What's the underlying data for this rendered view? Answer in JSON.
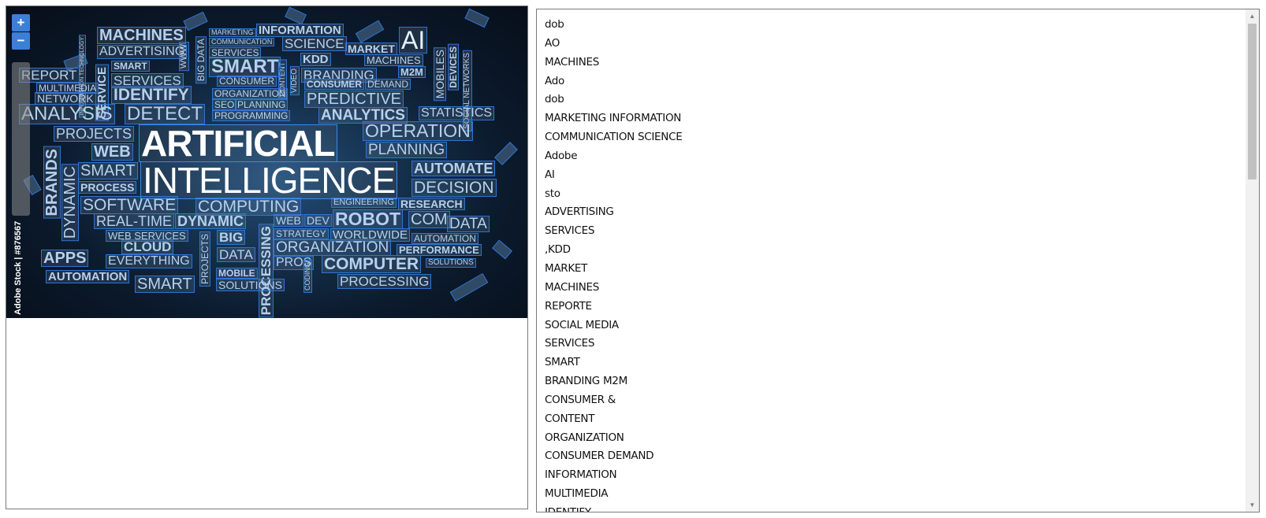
{
  "viewer": {
    "zoom_in_label": "+",
    "zoom_out_label": "−",
    "watermark": "Adobe Stock | #876567",
    "word_cloud": [
      "ARTIFICIAL",
      "INTELLIGENCE",
      "MACHINES",
      "ADVERTISING",
      "INFORMATION",
      "SCIENCE",
      "MARKETING",
      "COMMUNICATION",
      "SERVICES",
      "MARKET",
      "AI",
      "KDD",
      "MACHINES",
      "M2M",
      "BRANDING",
      "CONSUMER",
      "DEMAND",
      "SOCIAL MEDIA",
      "SMART",
      "REPORT",
      "MULTIMEDIA",
      "NETWORK",
      "IDENTIFY",
      "ORGANIZATION",
      "PREDICTIVE",
      "MOBILES",
      "DEVICES",
      "SOCIAL NETWORKS",
      "ANALYSIS",
      "DETECT",
      "SEO",
      "PLANNING",
      "PROGRAMMING",
      "ANALYTICS",
      "STATISTICS",
      "PROJECTS",
      "OPERATION",
      "WEB",
      "PLANNING",
      "BRANDS",
      "SMART",
      "AUTOMATE",
      "PROCESS",
      "DECISION",
      "SOFTWARE",
      "COMPUTING",
      "ENGINEERING",
      "RESEARCH",
      "SOLUTIONS",
      "REAL-TIME",
      "DYNAMIC",
      "WEB",
      "DEV",
      "ROBOT",
      "COM",
      "DATA",
      "WEB SERVICES",
      "STRATEGY",
      "WORLDWIDE",
      "AUTOMATION",
      "BIG",
      "DATA",
      "ORGANIZATION",
      "PERFORMANCE",
      "APPS",
      "CLOUD",
      "SOLUTIONS",
      "EVERYTHING",
      "PROS",
      "COMPUTER",
      "AUTOMATION",
      "SMART",
      "MOBILE",
      "SOLUTIONS",
      "PROCESSING",
      "SERVICE",
      "WWW",
      "BIG DATA",
      "CONTENT",
      "VIDEO",
      "SOFTWARE",
      "INFORMATION TECHNOLOGY",
      "PROJECTS",
      "CODING"
    ]
  },
  "list": {
    "items": [
      "dob",
      "AO",
      "MACHINES",
      "Ado",
      "dob",
      "MARKETING INFORMATION",
      "COMMUNICATION SCIENCE",
      "Adobe",
      "AI",
      "sto",
      "ADVERTISING",
      "SERVICES",
      ",KDD",
      "MARKET",
      "MACHINES",
      "REPORTE",
      "SOCIAL MEDIA",
      "SERVICES",
      "SMART",
      "BRANDING M2M",
      "CONSUMER &",
      "CONTENT",
      "ORGANIZATION",
      "CONSUMER DEMAND",
      "INFORMATION",
      "MULTIMEDIA",
      "IDENTIFY"
    ]
  },
  "scrollbar": {
    "up_icon": "triangle-up-icon",
    "down_icon": "triangle-down-icon",
    "position_fraction": 0.0
  }
}
